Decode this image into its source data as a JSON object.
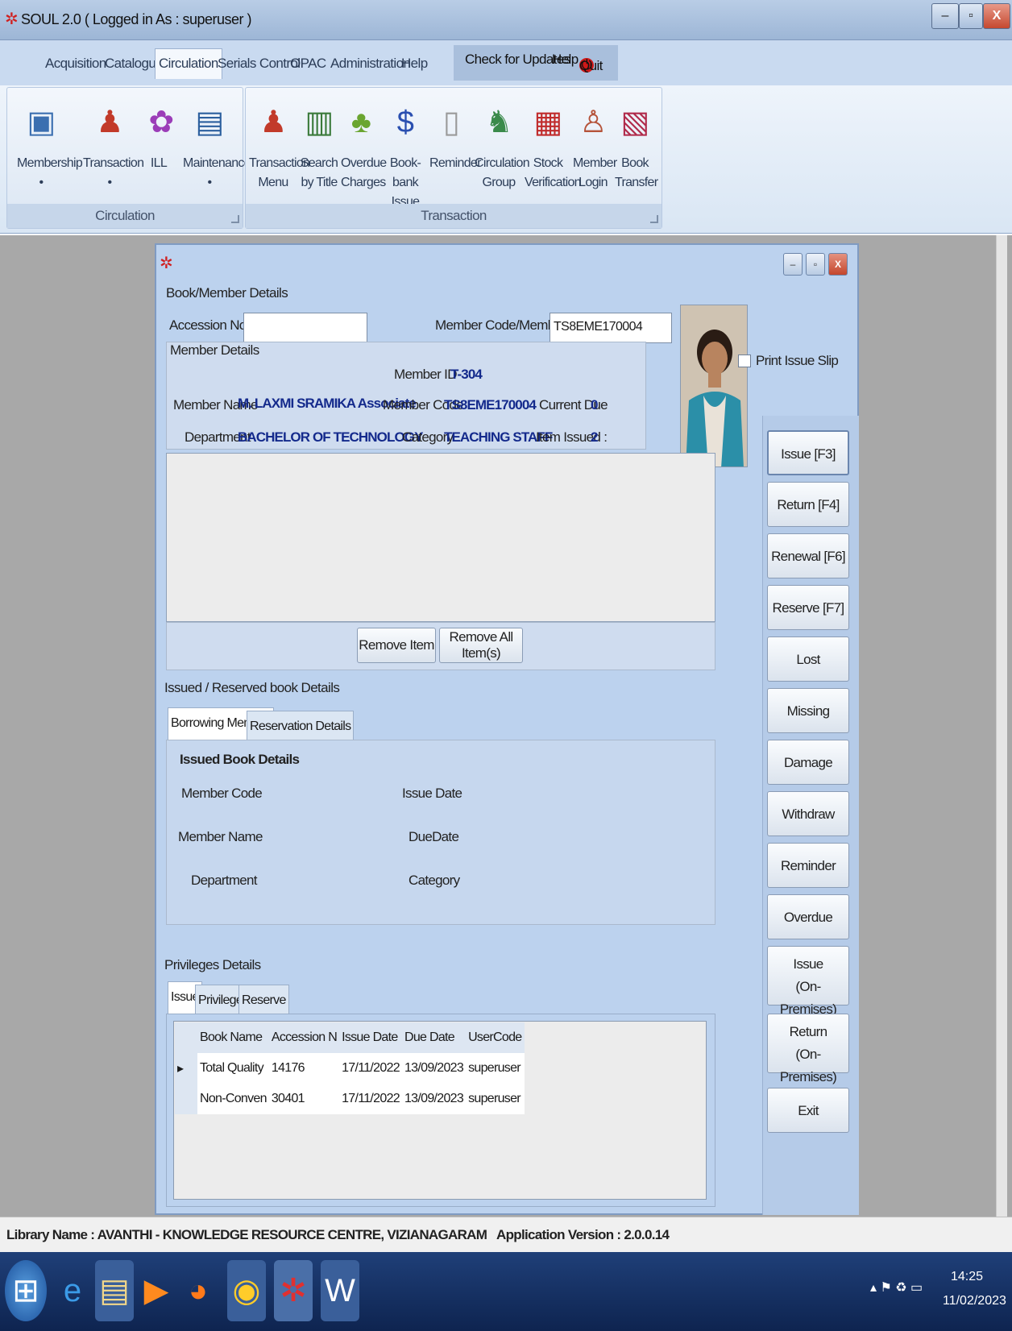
{
  "window": {
    "title": "SOUL 2.0 ( Logged in As : superuser )",
    "min": "–",
    "max": "▫",
    "close": "X"
  },
  "menu": {
    "items": [
      "Acquisition",
      "Catalogue",
      "Circulation",
      "Serials Control",
      "OPAC",
      "Administration",
      "Help"
    ],
    "check_updates": "Check for Updates",
    "help": "Help",
    "quit": "Quit"
  },
  "ribbon": {
    "circulation_group": {
      "label": "Circulation",
      "buttons": [
        {
          "label": "Membership",
          "sub": "•"
        },
        {
          "label": "Transaction",
          "sub": "•"
        },
        {
          "label": "ILL",
          "sub": ""
        },
        {
          "label": "Maintenance",
          "sub": "•"
        }
      ]
    },
    "transaction_group": {
      "label": "Transaction",
      "buttons": [
        {
          "l1": "Transaction",
          "l2": "Menu"
        },
        {
          "l1": "Search",
          "l2": "by Title"
        },
        {
          "l1": "Overdue",
          "l2": "Charges"
        },
        {
          "l1": "Book-bank",
          "l2": "Issue"
        },
        {
          "l1": "Reminder",
          "l2": ""
        },
        {
          "l1": "Circulation",
          "l2": "Group"
        },
        {
          "l1": "Stock",
          "l2": "Verification"
        },
        {
          "l1": "Member",
          "l2": "Login"
        },
        {
          "l1": "Book",
          "l2": "Transfer"
        }
      ]
    }
  },
  "book_member": {
    "group_title": "Book/Member Details",
    "accession_label": "Accession No",
    "accession_value": "",
    "member_code_label": "Member Code/Member ID",
    "member_code_value": "TS8EME170004",
    "print_issue_slip": "Print Issue Slip"
  },
  "member_details": {
    "group_title": "Member Details",
    "member_id_label": "Member ID",
    "member_id": "T-304",
    "member_name_label": "Member Name",
    "member_name": "M. LAXMI SRAMIKA Associate",
    "member_code_label": "Member Code",
    "member_code": "TS8EME170004",
    "current_due_label": "Current Due",
    "current_due": "0",
    "department_label": "Department",
    "department": "BACHELOR OF TECHNOLOGY",
    "category_label": "Category",
    "category": "TEACHING STAFF",
    "item_issued_label": "Item Issued :",
    "item_issued": "2"
  },
  "item_buttons": {
    "remove_item": "Remove Item",
    "remove_all": "Remove All Item(s)"
  },
  "issued_reserved": {
    "group_title": "Issued / Reserved book Details",
    "tabs": [
      "Borrowing Member",
      "Reservation Details"
    ],
    "issued_book_details": "Issued Book Details",
    "member_code": "Member Code",
    "issue_date": "Issue Date",
    "member_name": "Member Name",
    "due_date": "DueDate",
    "department": "Department",
    "category": "Category"
  },
  "privileges": {
    "group_title": "Privileges Details",
    "tabs": [
      "Issue",
      "Privileges",
      "Reserve"
    ],
    "columns": [
      "Book Name",
      "Accession N",
      "Issue Date",
      "Due Date",
      "UserCode"
    ],
    "rows": [
      {
        "book": "Total Quality",
        "acc": "14176",
        "issue": "17/11/2022",
        "due": "13/09/2023",
        "user": "superuser"
      },
      {
        "book": "Non-Conven",
        "acc": "30401",
        "issue": "17/11/2022",
        "due": "13/09/2023",
        "user": "superuser"
      }
    ]
  },
  "side_buttons": {
    "issue": "Issue [F3]",
    "return": "Return [F4]",
    "renewal": "Renewal [F6]",
    "reserve": "Reserve [F7]",
    "lost": "Lost",
    "missing": "Missing",
    "damage": "Damage",
    "withdraw": "Withdraw",
    "reminder": "Reminder",
    "overdue": "Overdue",
    "issue_op_1": "Issue",
    "issue_op_2": "(On-Premises)",
    "return_op_1": "Return",
    "return_op_2": "(On-Premises)",
    "exit": "Exit"
  },
  "status": {
    "library": "Library Name : AVANTHI - KNOWLEDGE RESOURCE CENTRE, VIZIANAGARAM",
    "version": "Application Version : 2.0.0.14"
  },
  "taskbar": {
    "time": "14:25",
    "date": "11/02/2023"
  },
  "colors": {
    "panel_bg": "#bcd2ee",
    "value_text": "#142a8c",
    "taskbar": "#1f3f78"
  }
}
